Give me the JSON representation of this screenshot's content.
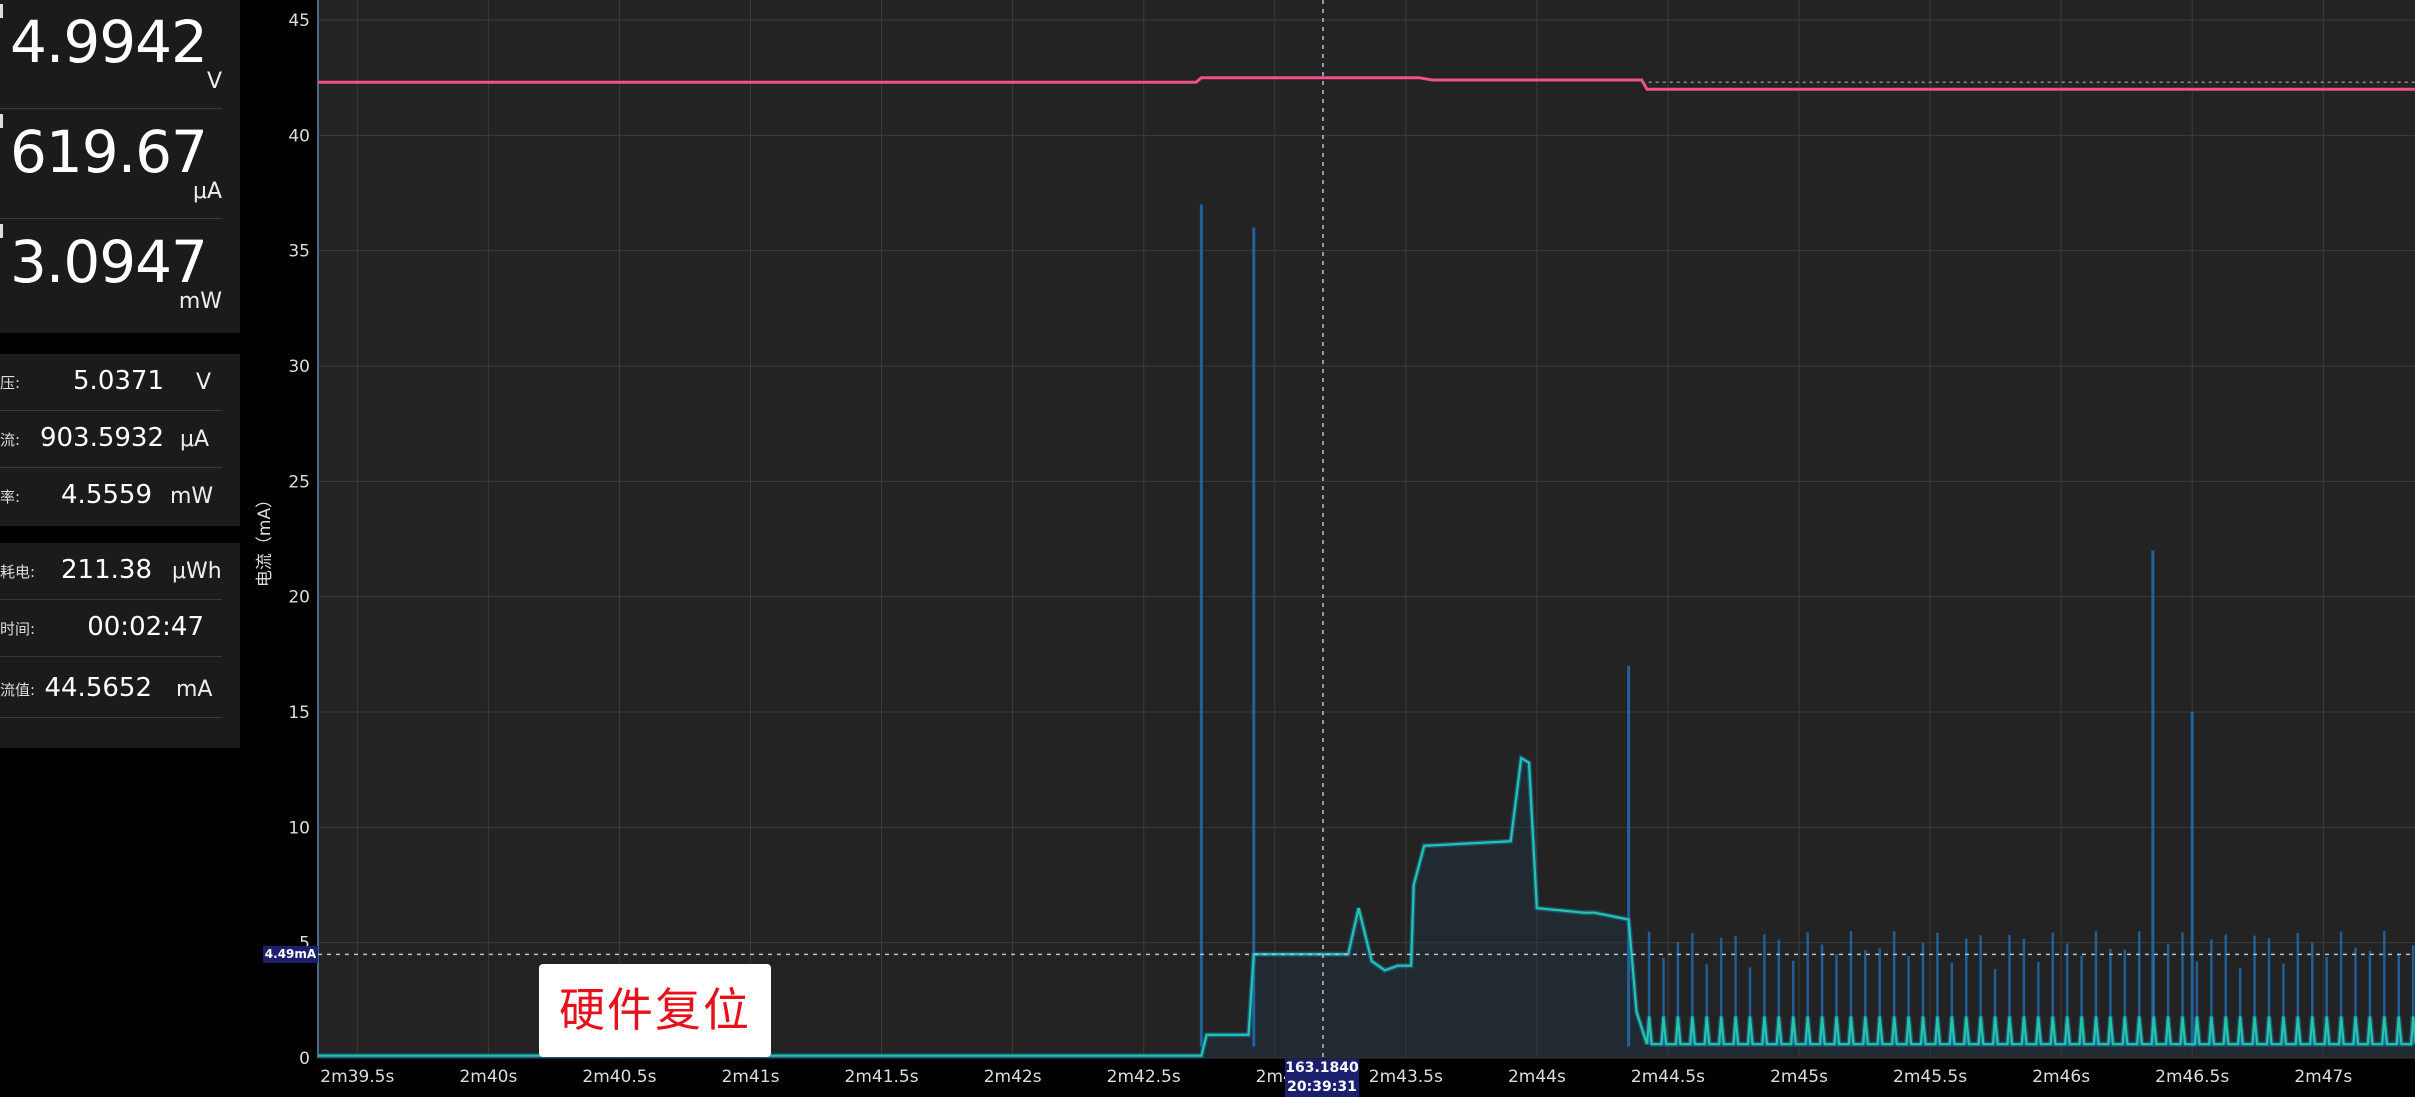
{
  "readouts": {
    "voltage": {
      "value": "4.9942",
      "unit": "V"
    },
    "current": {
      "value": "619.67",
      "unit": "μA"
    },
    "power": {
      "value": "3.0947",
      "unit": "mW"
    }
  },
  "averages": [
    {
      "label": "压:",
      "value": "5.0371",
      "unit": "V"
    },
    {
      "label": "流:",
      "value": "903.5932",
      "unit": "μA"
    },
    {
      "label": "率:",
      "value": "4.5559",
      "unit": "mW"
    }
  ],
  "totals": [
    {
      "label": "耗电:",
      "value": "211.38",
      "unit": "μWh"
    },
    {
      "label": "时间:",
      "value": "00:02:47",
      "unit": ""
    },
    {
      "label": "流值:",
      "value": "44.5652",
      "unit": "mA"
    }
  ],
  "annotation": "硬件复位",
  "cursor": {
    "value": "163.1840",
    "time": "20:39:31"
  },
  "reference": {
    "label": "4.49mA",
    "value": 4.49
  },
  "colors": {
    "background": "#232323",
    "grid": "#3c3c3c",
    "voltage_line": "#f0508c",
    "current_line": "#21c9a0",
    "current_envelope": "#1f6db3"
  },
  "chart_data": {
    "type": "line",
    "ylabel": "电流（mA）",
    "ylim": [
      0,
      45
    ],
    "yticks": [
      0,
      5,
      10,
      15,
      20,
      25,
      30,
      35,
      40,
      45
    ],
    "xlim": [
      159.35,
      167.35
    ],
    "xticks": [
      {
        "t": 159.5,
        "label": "2m39.5s"
      },
      {
        "t": 160.0,
        "label": "2m40s"
      },
      {
        "t": 160.5,
        "label": "2m40.5s"
      },
      {
        "t": 161.0,
        "label": "2m41s"
      },
      {
        "t": 161.5,
        "label": "2m41.5s"
      },
      {
        "t": 162.0,
        "label": "2m42s"
      },
      {
        "t": 162.5,
        "label": "2m42.5s"
      },
      {
        "t": 163.0,
        "label": "2m4"
      },
      {
        "t": 163.5,
        "label": "2m43.5s"
      },
      {
        "t": 164.0,
        "label": "2m44s"
      },
      {
        "t": 164.5,
        "label": "2m44.5s"
      },
      {
        "t": 165.0,
        "label": "2m45s"
      },
      {
        "t": 165.5,
        "label": "2m45.5s"
      },
      {
        "t": 166.0,
        "label": "2m46s"
      },
      {
        "t": 166.5,
        "label": "2m46.5s"
      },
      {
        "t": 167.0,
        "label": "2m47s"
      }
    ],
    "series": [
      {
        "role": "voltage",
        "x": [
          159.35,
          162.7,
          162.72,
          163.55,
          163.6,
          164.4,
          164.42,
          167.35
        ],
        "y": [
          42.3,
          42.3,
          42.5,
          42.5,
          42.4,
          42.4,
          42.0,
          42.0
        ]
      },
      {
        "role": "current",
        "x": [
          159.35,
          162.72,
          162.74,
          162.9,
          162.92,
          163.28,
          163.32,
          163.37,
          163.42,
          163.47,
          163.52,
          163.53,
          163.57,
          163.9,
          163.94,
          163.97,
          164.0,
          164.18,
          164.22,
          164.35,
          164.38,
          164.42,
          167.35
        ],
        "y": [
          0.1,
          0.1,
          1.0,
          1.0,
          4.5,
          4.5,
          6.5,
          4.2,
          3.8,
          4.0,
          4.0,
          7.5,
          9.2,
          9.4,
          13.0,
          12.8,
          6.5,
          6.3,
          6.3,
          6.0,
          2.0,
          0.6,
          0.6
        ]
      }
    ],
    "spikes": {
      "start": 164.42,
      "end": 167.35,
      "period": 0.055,
      "baseline": 0.6,
      "peak": 1.8,
      "envelope_peak": 5.5
    },
    "big_spikes": [
      {
        "x": 162.72,
        "y": 37
      },
      {
        "x": 162.92,
        "y": 36
      },
      {
        "x": 164.35,
        "y": 17
      },
      {
        "x": 166.35,
        "y": 22
      },
      {
        "x": 166.5,
        "y": 15
      }
    ]
  }
}
